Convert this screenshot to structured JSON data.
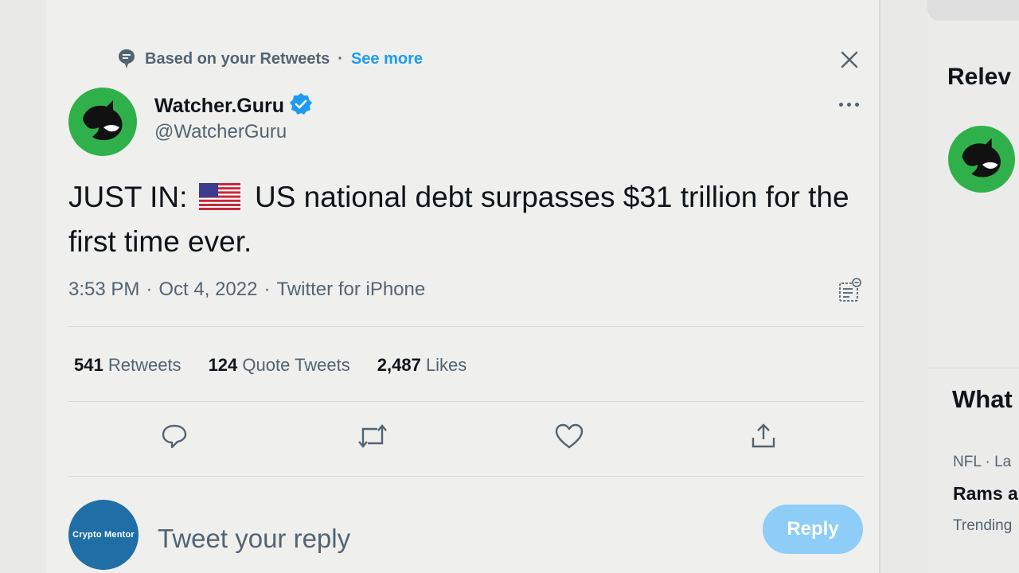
{
  "context": {
    "label": "Based on your Retweets",
    "separator": "·",
    "link": "See more"
  },
  "tweet": {
    "author_name": "Watcher.Guru",
    "handle": "@WatcherGuru",
    "text_prefix": "JUST IN:",
    "flag_icon": "us-flag-icon",
    "text_body": "US national debt surpasses $31 trillion for the first time ever.",
    "time": "3:53 PM",
    "date": "Oct 4, 2022",
    "source": "Twitter for iPhone",
    "sep": "·"
  },
  "stats": {
    "retweets_count": "541",
    "retweets_label": "Retweets",
    "quotes_count": "124",
    "quotes_label": "Quote Tweets",
    "likes_count": "2,487",
    "likes_label": "Likes"
  },
  "reply": {
    "avatar_text": "Crypto Mentor",
    "placeholder": "Tweet your reply",
    "button": "Reply"
  },
  "sidebar": {
    "relevant_heading": "Relev",
    "whats_heading": "What",
    "trend_meta": "NFL · La",
    "trend_title": "Rams a",
    "trend_sub": "Trending"
  },
  "colors": {
    "accent": "#1d9bf0",
    "avatar_green": "#2fb04a",
    "reply_button": "#8ecdf8"
  }
}
